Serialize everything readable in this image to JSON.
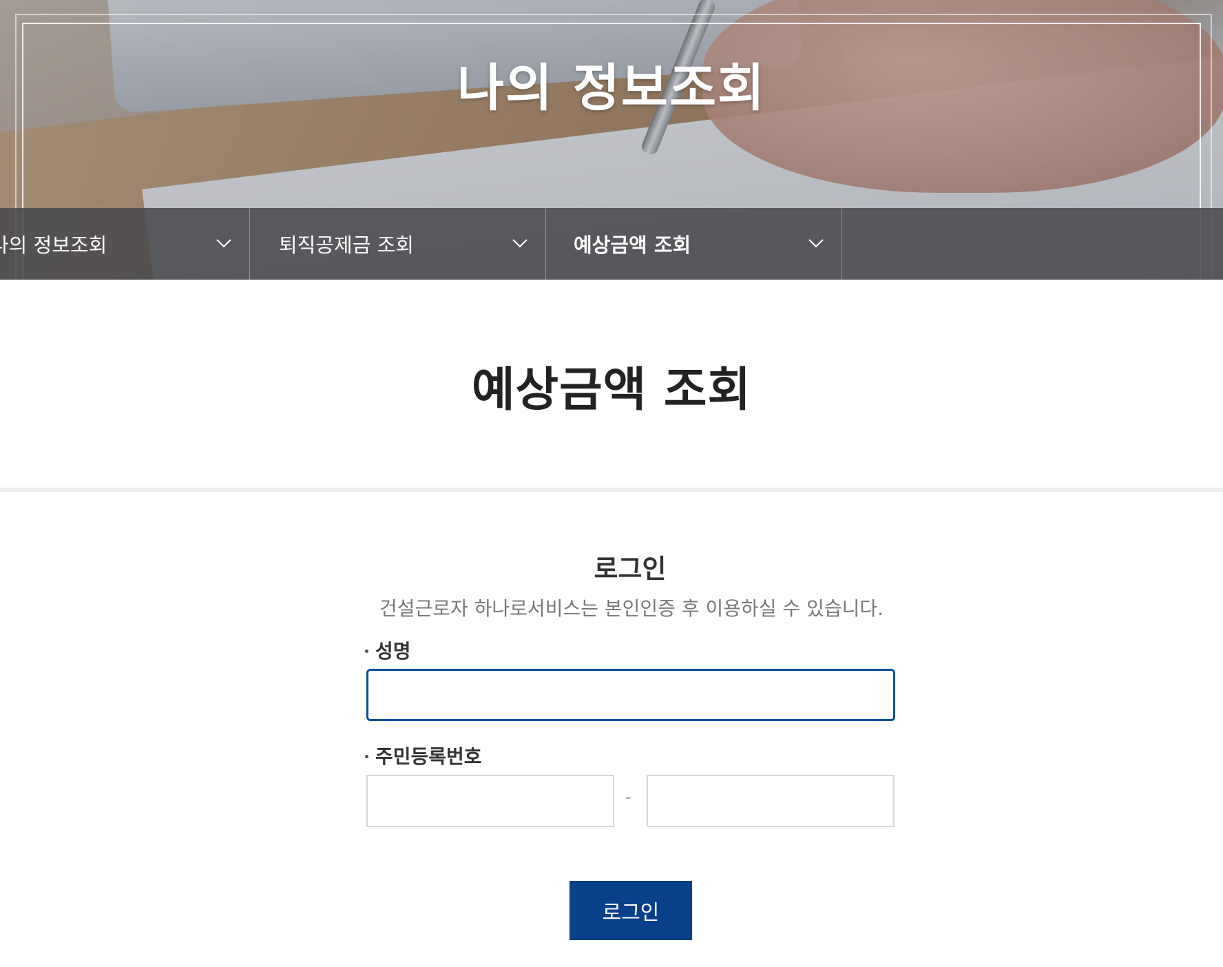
{
  "header": {
    "title": "나의 정보조회"
  },
  "tabs": [
    {
      "label": "나의 정보조회",
      "icon": "chevron-down-icon",
      "active": false
    },
    {
      "label": "퇴직공제금 조회",
      "icon": "chevron-down-icon",
      "active": false
    },
    {
      "label": "예상금액 조회",
      "icon": "chevron-down-icon",
      "active": true
    }
  ],
  "page": {
    "title": "예상금액 조회"
  },
  "login": {
    "heading": "로그인",
    "description": "건설근로자 하나로서비스는 본인인증 후 이용하실 수 있습니다.",
    "name_label": "성명",
    "name_value": "",
    "rrn_label": "주민등록번호",
    "rrn_first_value": "",
    "rrn_separator": "-",
    "rrn_second_value": "",
    "button_label": "로그인"
  },
  "colors": {
    "accent": "#0a3f8a",
    "focus_border": "#0b4ea2",
    "tabbar": "#48484c"
  }
}
